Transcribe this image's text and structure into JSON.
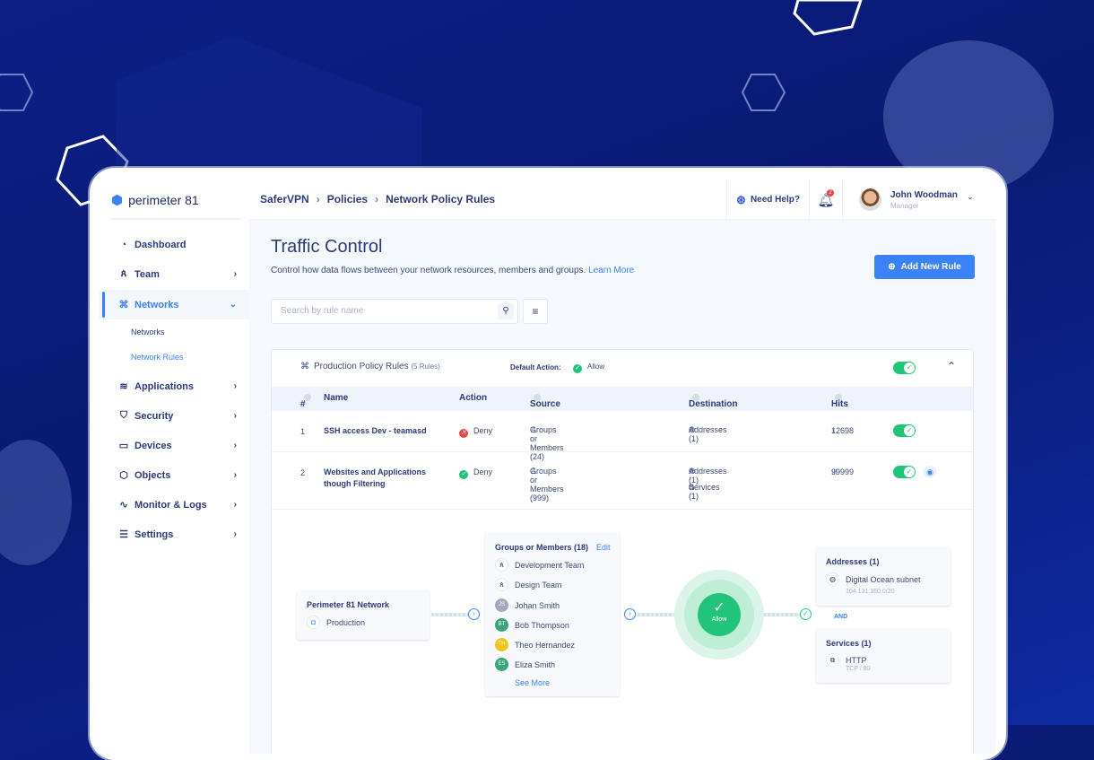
{
  "brand": {
    "name": "perimeter 81"
  },
  "sidebar": {
    "items": [
      {
        "label": "Dashboard",
        "icon": "dashboard-icon"
      },
      {
        "label": "Team",
        "icon": "team-icon"
      },
      {
        "label": "Networks",
        "icon": "networks-icon",
        "active": true,
        "sub": [
          "Networks",
          "Network Rules"
        ]
      },
      {
        "label": "Applications",
        "icon": "layers-icon"
      },
      {
        "label": "Security",
        "icon": "shield-icon"
      },
      {
        "label": "Devices",
        "icon": "monitor-icon"
      },
      {
        "label": "Objects",
        "icon": "cube-icon"
      },
      {
        "label": "Monitor & Logs",
        "icon": "activity-icon"
      },
      {
        "label": "Settings",
        "icon": "sliders-icon"
      }
    ]
  },
  "header": {
    "breadcrumb": [
      "SaferVPN",
      "Policies",
      "Network Policy Rules"
    ],
    "help": "Need Help?",
    "notifications": "2",
    "user": {
      "name": "John Woodman",
      "role": "Manager"
    }
  },
  "main": {
    "title": "Traffic Control",
    "subtitle": "Control how data flows between your network resources, members and groups.",
    "learn_more": "Learn More",
    "add_button": "Add New Rule",
    "search_placeholder": "Search by rule name"
  },
  "policy": {
    "name": "Production Policy Rules",
    "count": "(5 Rules)",
    "default_action_label": "Default Action:",
    "default_action": "Allow",
    "enabled": true,
    "columns": [
      "#",
      "Name",
      "Action",
      "Source",
      "Destination",
      "Hits"
    ],
    "rows": [
      {
        "num": "1",
        "name": "SSH access Dev - teamasd",
        "action": "Deny",
        "source": "Groups or Members (24)",
        "destination": [
          "Addresses (1)"
        ],
        "hits": "12698",
        "enabled": true
      },
      {
        "num": "2",
        "name": "Websites and Applications though Filtering",
        "action": "Deny",
        "source": "Groups or Members (999)",
        "destination": [
          "Addresses (1)",
          "Services (1)"
        ],
        "hits": "99999",
        "enabled": true
      }
    ]
  },
  "flow": {
    "network": {
      "title": "Perimeter 81 Network",
      "item": "Production"
    },
    "members": {
      "title": "Groups or Members (18)",
      "edit": "Edit",
      "see_more": "See More",
      "items": [
        {
          "name": "Development Team",
          "type": "group"
        },
        {
          "name": "Design Team",
          "type": "group"
        },
        {
          "name": "Johan Smith",
          "initials": "JS",
          "color": "#a3a9bd"
        },
        {
          "name": "Bob Thompson",
          "initials": "BT",
          "color": "#3aa57a"
        },
        {
          "name": "Theo Hernandez",
          "initials": "TH",
          "color": "#f2c318"
        },
        {
          "name": "Eliza Smith",
          "initials": "ES",
          "color": "#3aa57a"
        }
      ]
    },
    "action": "Allow",
    "addresses": {
      "title": "Addresses (1)",
      "name": "Digital Ocean subnet",
      "value": "104.131.160.0/20"
    },
    "and": "AND",
    "services": {
      "title": "Services (1)",
      "name": "HTTP",
      "value": "TCP / 80"
    }
  },
  "colors": {
    "accent": "#3b82f6",
    "success": "#22c47a",
    "danger": "#ef4444",
    "text": "#2b3a7a"
  }
}
